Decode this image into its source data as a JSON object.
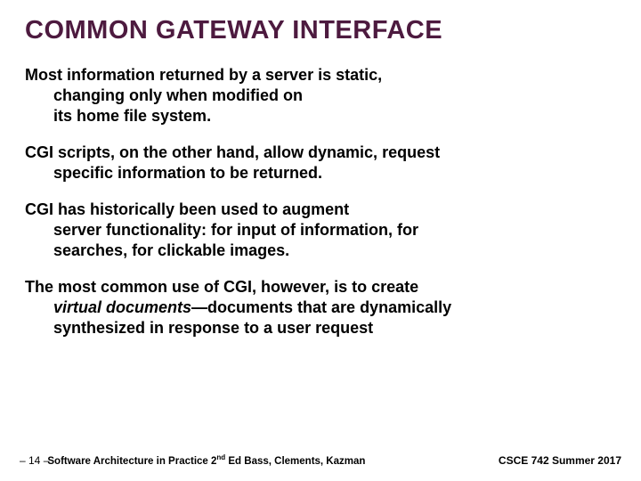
{
  "title": "COMMON GATEWAY INTERFACE",
  "paragraphs": {
    "p1": {
      "line1": "Most information returned by a server is static,",
      "line2": "changing only when modified on",
      "line3": "its home file system."
    },
    "p2": {
      "line1": "CGI scripts, on the other hand, allow dynamic, request",
      "line2": "specific information to be returned."
    },
    "p3": {
      "line1": "CGI has historically been used to augment",
      "line2": "server functionality: for input of information, for",
      "line3": "searches, for clickable images."
    },
    "p4": {
      "line1": "The most common use of CGI, however, is to create",
      "line2a": "virtual documents",
      "line2b": "—documents that are dynamically",
      "line3": "synthesized in response to a user request"
    }
  },
  "footer": {
    "page": "– 14 –",
    "book_prefix": "Software Architecture in Practice 2",
    "book_sup": "nd",
    "book_suffix": " Ed  Bass, Clements, Kazman",
    "course": "CSCE 742 Summer 2017"
  }
}
